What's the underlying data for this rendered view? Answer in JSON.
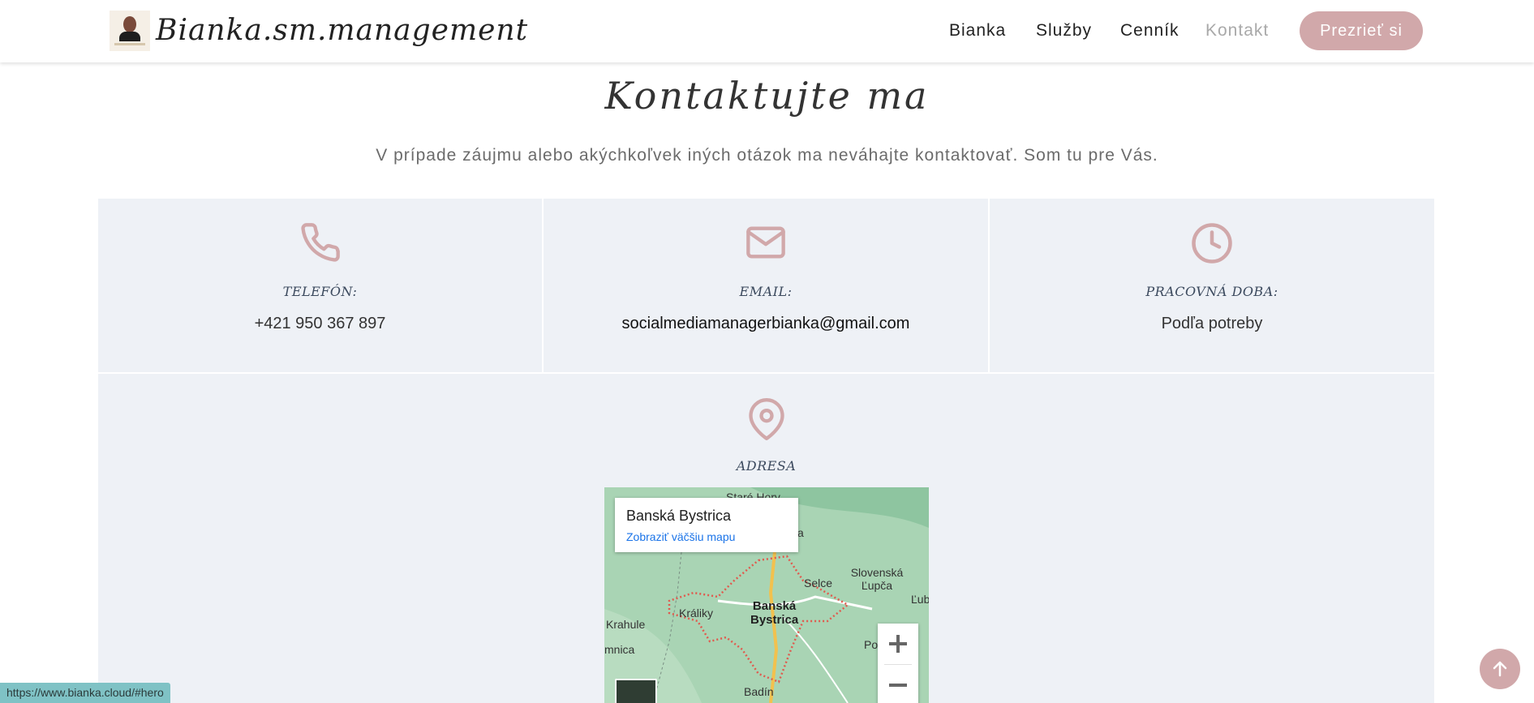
{
  "header": {
    "brand": "Bianka.sm.management",
    "nav": [
      {
        "label": "Bianka",
        "active": false
      },
      {
        "label": "Služby",
        "active": false
      },
      {
        "label": "Cenník",
        "active": false
      },
      {
        "label": "Kontakt",
        "active": true
      }
    ],
    "cta": "Prezrieť si"
  },
  "section": {
    "title": "Kontaktujte ma",
    "subtitle": "V prípade záujmu alebo akýchkoľvek iných otázok ma neváhajte kontaktovať. Som tu pre Vás."
  },
  "contacts": {
    "phone": {
      "icon": "phone-icon",
      "label": "TELEFÓN:",
      "value": "+421 950 367 897"
    },
    "email": {
      "icon": "envelope-icon",
      "label": "EMAIL:",
      "value": "socialmediamanagerbianka@gmail.com"
    },
    "hours": {
      "icon": "clock-icon",
      "label": "PRACOVNÁ DOBA:",
      "value": "Podľa potreby"
    },
    "address": {
      "icon": "map-pin-icon",
      "label": "ADRESA"
    }
  },
  "map": {
    "place_title": "Banská Bystrica",
    "larger_map_link": "Zobraziť väčšiu mapu",
    "labels": {
      "stare_hory": "Staré Hory",
      "selce": "Selce",
      "slovenska_lupca": "Slovenská\nĽupča",
      "lub": "Ľub",
      "kraliky": "Králiky",
      "banska_bystrica": "Banská\nBystrica",
      "krahule": "Krahule",
      "mnica": "mnica",
      "po": "Po",
      "badin": "Badín",
      "a": "a"
    }
  },
  "status_url": "https://www.bianka.cloud/#hero",
  "colors": {
    "accent": "#d1a8aa",
    "box_bg": "#eef1f6",
    "nav_active": "#a9a9a9",
    "link": "#1a73e8"
  }
}
